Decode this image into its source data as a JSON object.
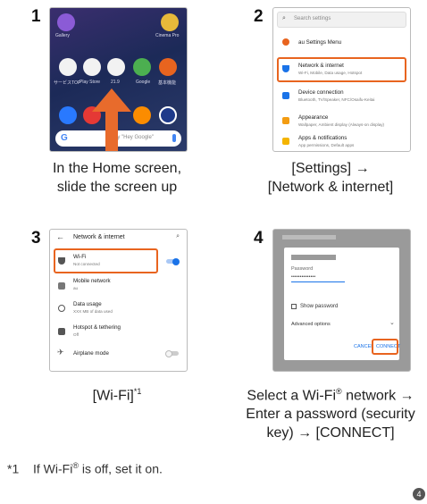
{
  "steps": [
    {
      "number": "1",
      "caption": [
        "In the Home screen,",
        "slide the screen up"
      ]
    },
    {
      "number": "2",
      "caption": [
        "[Settings] →",
        "[Network & internet]"
      ]
    },
    {
      "number": "3",
      "caption": [
        "[Wi-Fi]",
        "*1"
      ]
    },
    {
      "number": "4",
      "caption": [
        "Select a Wi-Fi",
        "®",
        " network →",
        "Enter a password (security",
        "key) → [CONNECT]"
      ]
    }
  ],
  "home": {
    "apps_top": [
      "Gallery",
      "Cinema Pro"
    ],
    "apps_row": [
      "サービスTOP",
      "Play Store",
      "21.9",
      "Google",
      "基本機能"
    ],
    "search_hint": "Say \"Hey Google\""
  },
  "settings": {
    "search_placeholder": "Search settings",
    "items": [
      {
        "title": "au Settings Menu",
        "sub": ""
      },
      {
        "title": "Network & internet",
        "sub": "Wi-Fi, Mobile, Data usage, Hotspot"
      },
      {
        "title": "Device connection",
        "sub": "Bluetooth, TV/Speaker, NFC/Osaifu-Keitai"
      },
      {
        "title": "Appearance",
        "sub": "Wallpaper, Ambient display (Always-on display)"
      },
      {
        "title": "Apps & notifications",
        "sub": "App permissions, Default apps"
      }
    ]
  },
  "network": {
    "title": "Network & internet",
    "items": [
      {
        "title": "Wi-Fi",
        "sub": "Not connected"
      },
      {
        "title": "Mobile network",
        "sub": "au"
      },
      {
        "title": "Data usage",
        "sub": "XXX MB of data used"
      },
      {
        "title": "Hotspot & tethering",
        "sub": "Off"
      },
      {
        "title": "Airplane mode",
        "sub": ""
      }
    ]
  },
  "dialog": {
    "password_label": "Password",
    "password_value": "••••••••••••••",
    "show_password": "Show password",
    "advanced": "Advanced options",
    "cancel": "CANCEL",
    "connect": "CONNECT"
  },
  "footnote": {
    "mark": "*1",
    "text": "If Wi-Fi",
    "reg": "®",
    "text_end": " is off, set it on."
  },
  "page_badge": "4",
  "colors": {
    "accent": "#e8641f",
    "blue": "#1a73e8"
  }
}
